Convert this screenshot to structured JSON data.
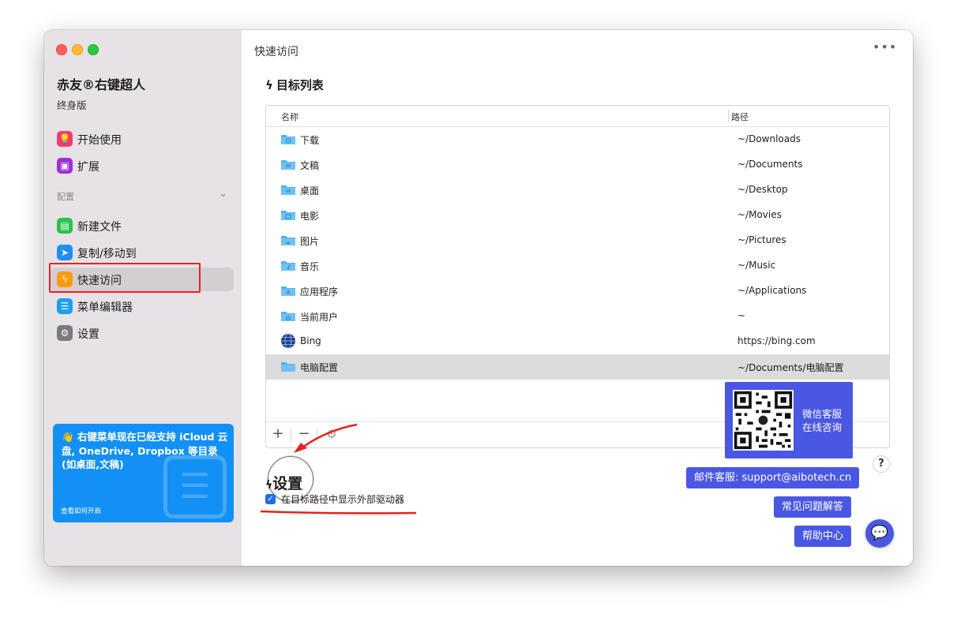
{
  "sidebar": {
    "app_name": "赤友®右键超人",
    "edition": "终身版",
    "items": [
      {
        "label": "开始使用",
        "icon": "bulb-icon",
        "color": "#f43b6c"
      },
      {
        "label": "扩展",
        "icon": "extension-icon",
        "color": "#9d2fd4"
      }
    ],
    "section_label": "配置",
    "config_items": [
      {
        "label": "新建文件",
        "icon": "new-file-icon",
        "color": "#2bc24a"
      },
      {
        "label": "复制/移动到",
        "icon": "send-icon",
        "color": "#1f8ff3"
      },
      {
        "label": "快速访问",
        "icon": "lightning-icon",
        "color": "#ff9b0c"
      },
      {
        "label": "菜单编辑器",
        "icon": "list-icon",
        "color": "#1a9ff0"
      },
      {
        "label": "设置",
        "icon": "gear-icon",
        "color": "#7a7a7a"
      }
    ],
    "promo_text": "👋 右键菜单现在已经支持 iCloud 云盘, OneDrive, Dropbox 等目录 (如桌面,文稿)",
    "promo_link": "查看如何开启"
  },
  "main": {
    "title": "快速访问",
    "section_title": "目标列表",
    "table": {
      "col_name": "名称",
      "col_path": "路径",
      "rows": [
        {
          "name": "下载",
          "path": "~/Downloads",
          "icon": "downloads-folder-icon"
        },
        {
          "name": "文稿",
          "path": "~/Documents",
          "icon": "documents-folder-icon"
        },
        {
          "name": "桌面",
          "path": "~/Desktop",
          "icon": "desktop-folder-icon"
        },
        {
          "name": "电影",
          "path": "~/Movies",
          "icon": "movies-folder-icon"
        },
        {
          "name": "图片",
          "path": "~/Pictures",
          "icon": "pictures-folder-icon"
        },
        {
          "name": "音乐",
          "path": "~/Music",
          "icon": "music-folder-icon"
        },
        {
          "name": "应用程序",
          "path": "~/Applications",
          "icon": "applications-folder-icon"
        },
        {
          "name": "当前用户",
          "path": "~",
          "icon": "home-folder-icon"
        },
        {
          "name": "Bing",
          "path": "https://bing.com",
          "icon": "globe-icon"
        },
        {
          "name": "电脑配置",
          "path": "~/Documents/电脑配置",
          "icon": "folder-icon"
        }
      ]
    },
    "settings_title": "设置",
    "checkbox_label": "在目标路径中显示外部驱动器",
    "checkbox_checked": true
  },
  "support": {
    "wechat_line1": "微信客服",
    "wechat_line2": "在线咨询",
    "email_label": "邮件客服: support@aibotech.cn",
    "faq_label": "常见问题解答",
    "help_label": "帮助中心",
    "help_symbol": "?",
    "accent": "#4a57e3"
  }
}
